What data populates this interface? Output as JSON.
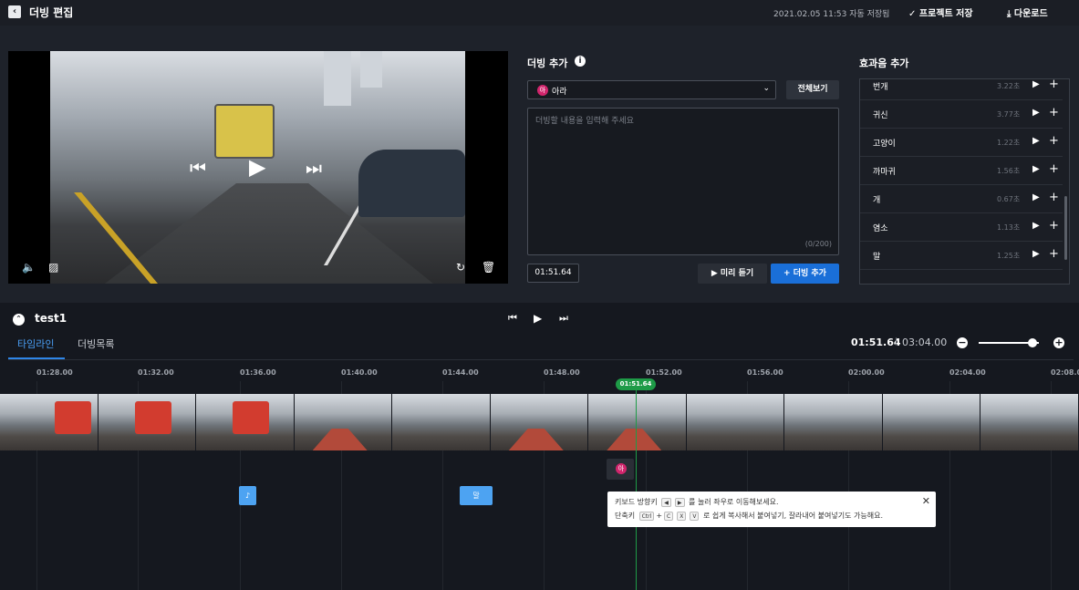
{
  "header": {
    "title": "더빙 편집",
    "autosave": "2021.02.05 11:53 자동 저장됨",
    "save_project": "프로젝트 저장",
    "download": "다운로드"
  },
  "dubbing": {
    "title": "더빙 추가",
    "voice_avatar": "아",
    "voice_name": "아라",
    "view_all": "전체보기",
    "placeholder": "더빙할 내용을 입력해 주세요",
    "char_count": "(0/200)",
    "time_value": "01:51.64",
    "preview": "미리 듣기",
    "add": "더빙 추가"
  },
  "sfx": {
    "title": "효과음 추가",
    "items": [
      {
        "name": "번개",
        "duration": "3.22초"
      },
      {
        "name": "귀신",
        "duration": "3.77초"
      },
      {
        "name": "고양이",
        "duration": "1.22초"
      },
      {
        "name": "까마귀",
        "duration": "1.56초"
      },
      {
        "name": "개",
        "duration": "0.67초"
      },
      {
        "name": "염소",
        "duration": "1.13초"
      },
      {
        "name": "말",
        "duration": "1.25초"
      }
    ]
  },
  "timeline": {
    "project_name": "test1",
    "tabs": [
      "타임라인",
      "더빙목록"
    ],
    "current_time": "01:51.64",
    "total_time": "03:04.00",
    "ruler": [
      "01:28.00",
      "01:32.00",
      "01:36.00",
      "01:40.00",
      "01:44.00",
      "01:48.00",
      "01:52.00",
      "01:56.00",
      "02:00.00",
      "02:04.00",
      "02:08.0"
    ],
    "playhead": "01:51.64",
    "clip_marker": "아",
    "clip_b": "말",
    "clip_a": "♪"
  },
  "tooltip": {
    "line1_a": "키보드 방향키",
    "line1_b": "를 눌러 좌우로 이동해보세요.",
    "line2_a": "단축키",
    "line2_b": "로 쉽게 복사해서 붙여넣기, 잘라내어 붙여넣기도 가능해요.",
    "key_left": "◀",
    "key_right": "▶",
    "key_ctrl": "Ctrl",
    "key_c": "C",
    "key_x": "X",
    "key_v": "V"
  },
  "colors": {
    "accent": "#1a6fd8",
    "playhead": "#1e9b47",
    "avatar": "#d1256c"
  }
}
